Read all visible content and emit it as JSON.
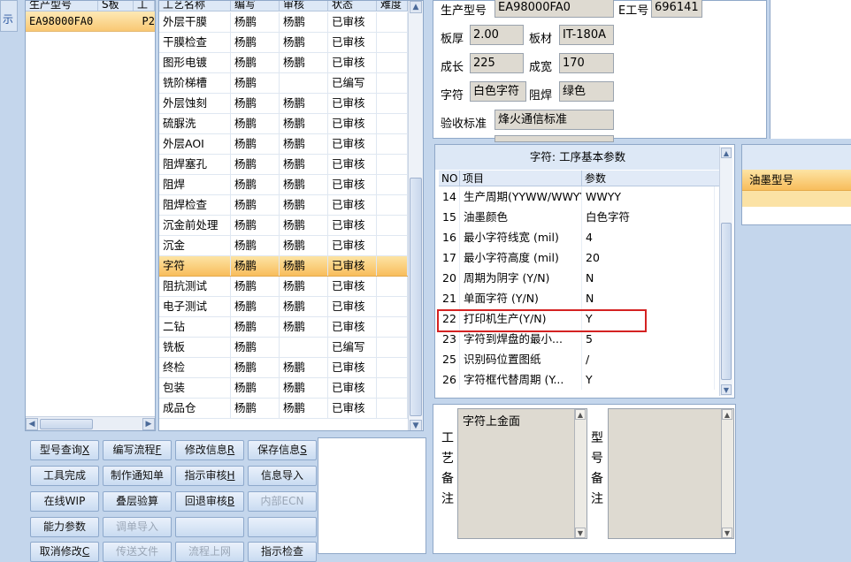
{
  "left_tab": "示",
  "model_grid": {
    "headers": [
      "生产型号",
      "S板",
      "工"
    ],
    "row": {
      "model": "EA98000FA0",
      "board": "",
      "extra": "P2"
    }
  },
  "process_grid": {
    "headers": [
      "工艺名称",
      "编写",
      "审核",
      "状态",
      "难度"
    ],
    "rows": [
      {
        "name": "外层干膜",
        "writer": "杨鹏",
        "reviewer": "杨鹏",
        "status": "已审核"
      },
      {
        "name": "干膜检查",
        "writer": "杨鹏",
        "reviewer": "杨鹏",
        "status": "已审核"
      },
      {
        "name": "图形电镀",
        "writer": "杨鹏",
        "reviewer": "杨鹏",
        "status": "已审核"
      },
      {
        "name": "铣阶梯槽",
        "writer": "杨鹏",
        "reviewer": "",
        "status": "已编写"
      },
      {
        "name": "外层蚀刻",
        "writer": "杨鹏",
        "reviewer": "杨鹏",
        "status": "已审核"
      },
      {
        "name": "硫脲洗",
        "writer": "杨鹏",
        "reviewer": "杨鹏",
        "status": "已审核"
      },
      {
        "name": "外层AOI",
        "writer": "杨鹏",
        "reviewer": "杨鹏",
        "status": "已审核"
      },
      {
        "name": "阻焊塞孔",
        "writer": "杨鹏",
        "reviewer": "杨鹏",
        "status": "已审核"
      },
      {
        "name": "阻焊",
        "writer": "杨鹏",
        "reviewer": "杨鹏",
        "status": "已审核"
      },
      {
        "name": "阻焊检查",
        "writer": "杨鹏",
        "reviewer": "杨鹏",
        "status": "已审核"
      },
      {
        "name": "沉金前处理",
        "writer": "杨鹏",
        "reviewer": "杨鹏",
        "status": "已审核"
      },
      {
        "name": "沉金",
        "writer": "杨鹏",
        "reviewer": "杨鹏",
        "status": "已审核"
      },
      {
        "name": "字符",
        "writer": "杨鹏",
        "reviewer": "杨鹏",
        "status": "已审核",
        "selected": true
      },
      {
        "name": "阻抗测试",
        "writer": "杨鹏",
        "reviewer": "杨鹏",
        "status": "已审核"
      },
      {
        "name": "电子测试",
        "writer": "杨鹏",
        "reviewer": "杨鹏",
        "status": "已审核"
      },
      {
        "name": "二钻",
        "writer": "杨鹏",
        "reviewer": "杨鹏",
        "status": "已审核"
      },
      {
        "name": "铣板",
        "writer": "杨鹏",
        "reviewer": "",
        "status": "已编写"
      },
      {
        "name": "终检",
        "writer": "杨鹏",
        "reviewer": "杨鹏",
        "status": "已审核"
      },
      {
        "name": "包装",
        "writer": "杨鹏",
        "reviewer": "杨鹏",
        "status": "已审核"
      },
      {
        "name": "成品仓",
        "writer": "杨鹏",
        "reviewer": "杨鹏",
        "status": "已审核"
      }
    ]
  },
  "buttons": {
    "model_query": "型号查询",
    "model_query_key": "X",
    "write_flow": "编写流程",
    "write_flow_key": "F",
    "modify_info": "修改信息",
    "modify_info_key": "R",
    "save_info": "保存信息",
    "save_info_key": "S",
    "tool_done": "工具完成",
    "make_notice": "制作通知单",
    "instruction_review": "指示审核",
    "instruction_review_key": "H",
    "info_import": "信息导入",
    "online_wip": "在线WIP",
    "stack_check": "叠层验算",
    "revert_review": "回退审核",
    "revert_review_key": "B",
    "internal_ecn": "内部ECN",
    "capability_params": "能力参数",
    "adjust_import": "调单导入",
    "cancel_modify": "取消修改",
    "cancel_modify_key": "C",
    "send_file": "传送文件",
    "flow_online": "流程上网",
    "instruction_check": "指示检查"
  },
  "info": {
    "model_label": "生产型号",
    "model_value": "EA98000FA0",
    "e_label": "E工号",
    "e_value": "696141",
    "thickness_label": "板厚",
    "thickness_value": "2.00",
    "material_label": "板材",
    "material_value": "IT-180A",
    "length_label": "成长",
    "length_value": "225",
    "width_label": "成宽",
    "width_value": "170",
    "char_label": "字符",
    "char_value": "白色字符",
    "mask_label": "阻焊",
    "mask_value": "绿色",
    "standard_label": "验收标准",
    "standard_value": "烽火通信标准"
  },
  "params": {
    "title": "字符: 工序基本参数",
    "headers": [
      "NO",
      "项目",
      "参数"
    ],
    "rows": [
      {
        "no": "14",
        "item": "生产周期(YYWW/WWYY)",
        "value": "WWYY"
      },
      {
        "no": "15",
        "item": "油墨颜色",
        "value": "白色字符"
      },
      {
        "no": "16",
        "item": "最小字符线宽 (mil)",
        "value": "4"
      },
      {
        "no": "17",
        "item": "最小字符高度 (mil)",
        "value": "20"
      },
      {
        "no": "20",
        "item": "周期为阴字 (Y/N)",
        "value": "N"
      },
      {
        "no": "21",
        "item": "单面字符 (Y/N)",
        "value": "N"
      },
      {
        "no": "22",
        "item": "打印机生产(Y/N)",
        "value": "Y"
      },
      {
        "no": "23",
        "item": "字符到焊盘的最小...",
        "value": "5"
      },
      {
        "no": "25",
        "item": "识别码位置图纸",
        "value": "/"
      },
      {
        "no": "26",
        "item": "字符框代替周期 (Y...",
        "value": "Y"
      }
    ]
  },
  "ink_panel": {
    "header": "油墨型号"
  },
  "notes": {
    "process_label": "工艺备注",
    "process_text": "字符上金面",
    "model_label": "型号备注",
    "model_text": ""
  }
}
